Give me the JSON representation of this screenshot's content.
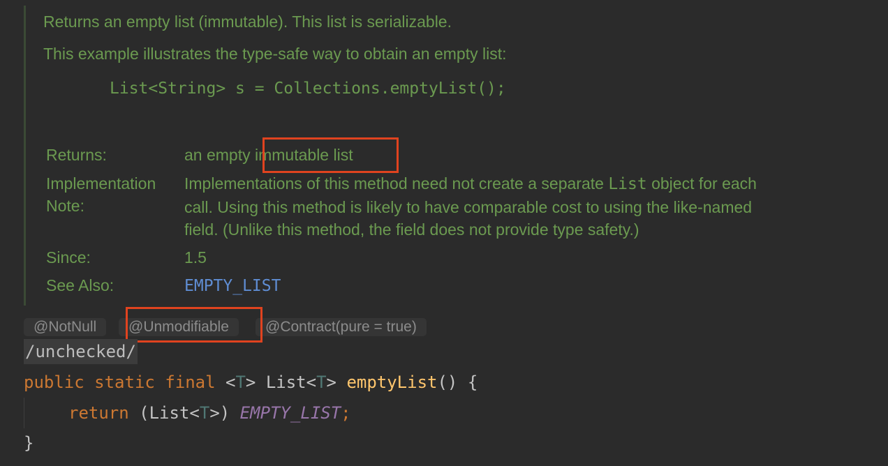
{
  "doc": {
    "summary": "Returns an empty list (immutable). This list is serializable.",
    "example_intro": "This example illustrates the type-safe way to obtain an empty list:",
    "example_code": "List<String> s = Collections.emptyList();",
    "returns_label": "Returns:",
    "returns_prefix": "an empty",
    "returns_highlight": "immutable list",
    "impl_label_1": "Implementation",
    "impl_label_2": "Note:",
    "impl_line1_a": "Implementations of this method need not create a separate",
    "impl_line1_code": "List",
    "impl_line1_b": "object for each",
    "impl_line2": "call. Using this method is likely to have comparable cost to using the like-named",
    "impl_line3": "field. (Unlike this method, the field does not provide type safety.)",
    "since_label": "Since:",
    "since_value": "1.5",
    "see_also_label": "See Also:",
    "see_also_link": "EMPTY_LIST"
  },
  "annotations": {
    "not_null": "@NotNull",
    "unmodifiable": "@Unmodifiable",
    "contract": "@Contract(pure = true)"
  },
  "code": {
    "suppress": "/unchecked/",
    "kw_public": "public",
    "kw_static": "static",
    "kw_final": "final",
    "generic_open": "<",
    "type_param": "T",
    "generic_close": ">",
    "return_type": "List",
    "method_name": "emptyList",
    "params": "() {",
    "kw_return": "return",
    "cast_open": "(List<",
    "cast_close": ">)",
    "field": "EMPTY_LIST",
    "semicolon": ";",
    "closing_brace": "}"
  },
  "colors": {
    "doc_text": "#6b9a50",
    "link": "#5f8dd3",
    "keyword": "#cc7832",
    "method": "#ffc66d",
    "constant": "#9876aa",
    "highlight_box": "#e0431f",
    "background": "#2b2b2b"
  }
}
